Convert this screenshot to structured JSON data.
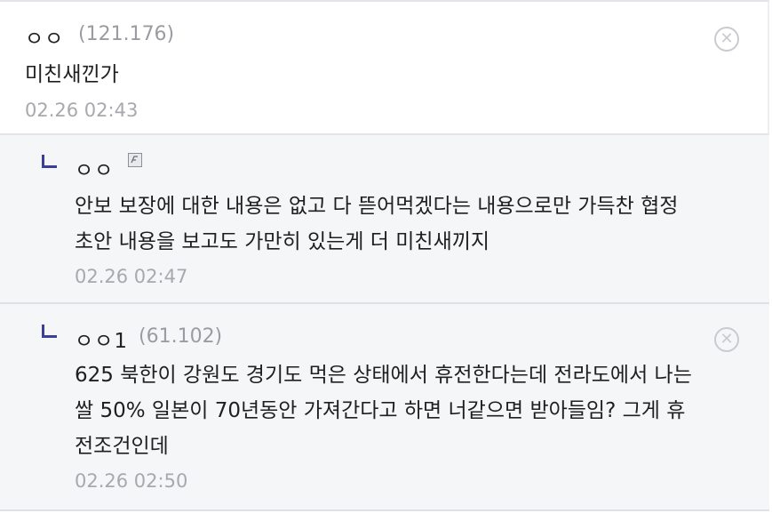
{
  "comments": [
    {
      "nickname": "ㅇㅇ",
      "ip": "(121.176)",
      "text": "미친새낀가",
      "date": "02.26 02:43",
      "icon": "close-icon"
    }
  ],
  "replies": [
    {
      "nickname": "ㅇㅇ",
      "badge_icon": "fixed-nickname-icon",
      "text_lines": [
        "안보 보장에 대한 내용은 없고 다 뜯어먹겠다는 내용으로만 가득찬 협정",
        "초안 내용을 보고도 가만히 있는게 더 미친새끼지"
      ],
      "date": "02.26 02:47"
    },
    {
      "nickname": "ㅇㅇ1",
      "ip": "(61.102)",
      "text_lines": [
        "625 북한이 강원도 경기도 먹은 상태에서 휴전한다는데 전라도에서 나는",
        "쌀 50% 일본이 70년동안 가져간다고 하면 너같으면 받아들임? 그게 휴",
        "전조건인데"
      ],
      "date": "02.26 02:50",
      "icon": "close-icon"
    }
  ],
  "ui": {
    "close_glyph": "✕",
    "reply_icon": "reply-arrow-icon"
  }
}
